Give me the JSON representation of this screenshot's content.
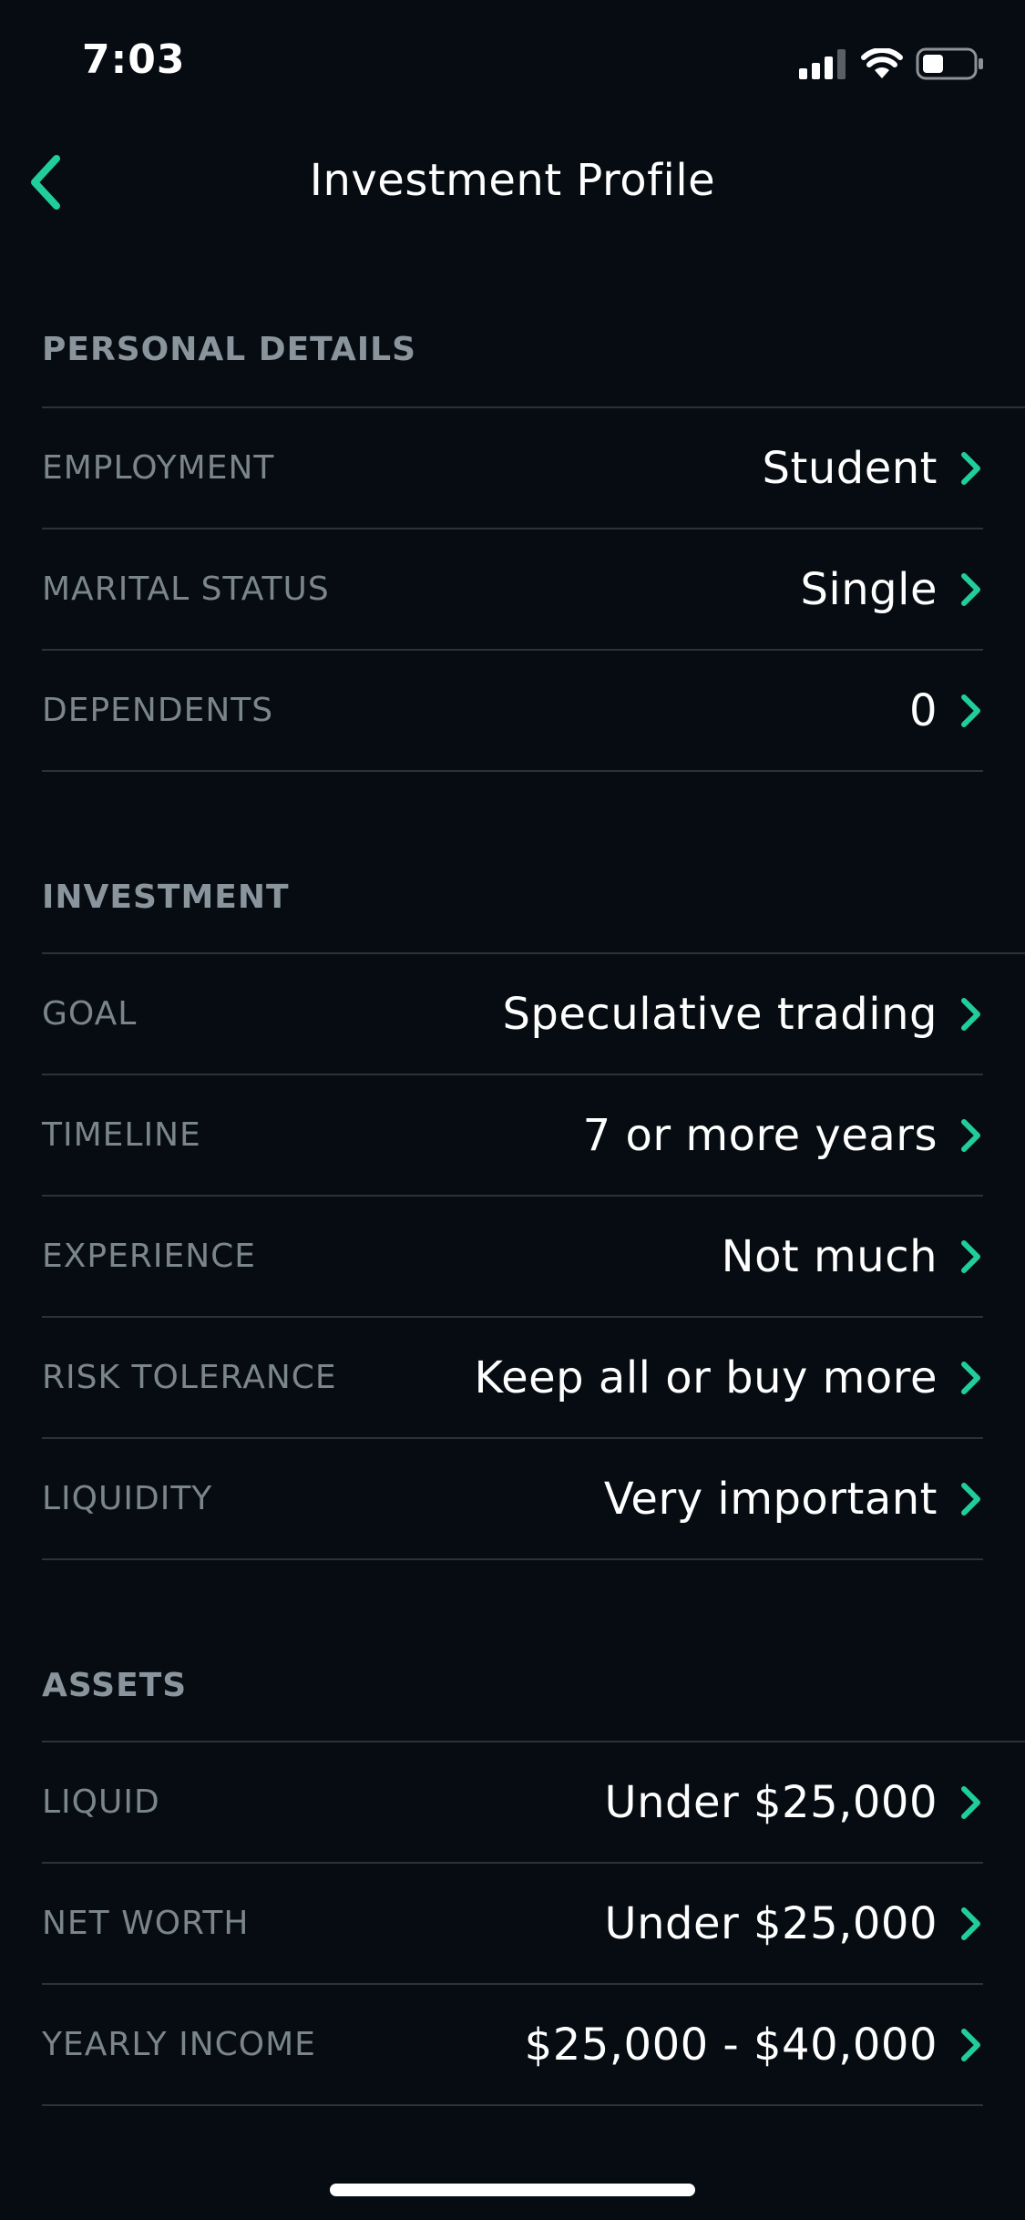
{
  "status_bar": {
    "time": "7:03",
    "icons": [
      "signal-icon",
      "wifi-icon",
      "battery-icon"
    ]
  },
  "nav": {
    "title": "Investment Profile",
    "back_icon": "chevron-left-icon"
  },
  "colors": {
    "background": "#060c12",
    "accent": "#21ce99",
    "label": "#7b858c",
    "section_header": "#8a949c",
    "divider": "#2a3339"
  },
  "sections": [
    {
      "title": "PERSONAL DETAILS",
      "rows": [
        {
          "label": "EMPLOYMENT",
          "value": "Student"
        },
        {
          "label": "MARITAL STATUS",
          "value": "Single"
        },
        {
          "label": "DEPENDENTS",
          "value": "0"
        }
      ]
    },
    {
      "title": "INVESTMENT",
      "rows": [
        {
          "label": "GOAL",
          "value": "Speculative trading"
        },
        {
          "label": "TIMELINE",
          "value": "7 or more years"
        },
        {
          "label": "EXPERIENCE",
          "value": "Not much"
        },
        {
          "label": "RISK TOLERANCE",
          "value": "Keep all or buy more"
        },
        {
          "label": "LIQUIDITY",
          "value": "Very important"
        }
      ]
    },
    {
      "title": "ASSETS",
      "rows": [
        {
          "label": "LIQUID",
          "value": "Under $25,000"
        },
        {
          "label": "NET WORTH",
          "value": "Under $25,000"
        },
        {
          "label": "YEARLY INCOME",
          "value": "$25,000 - $40,000"
        }
      ]
    }
  ]
}
